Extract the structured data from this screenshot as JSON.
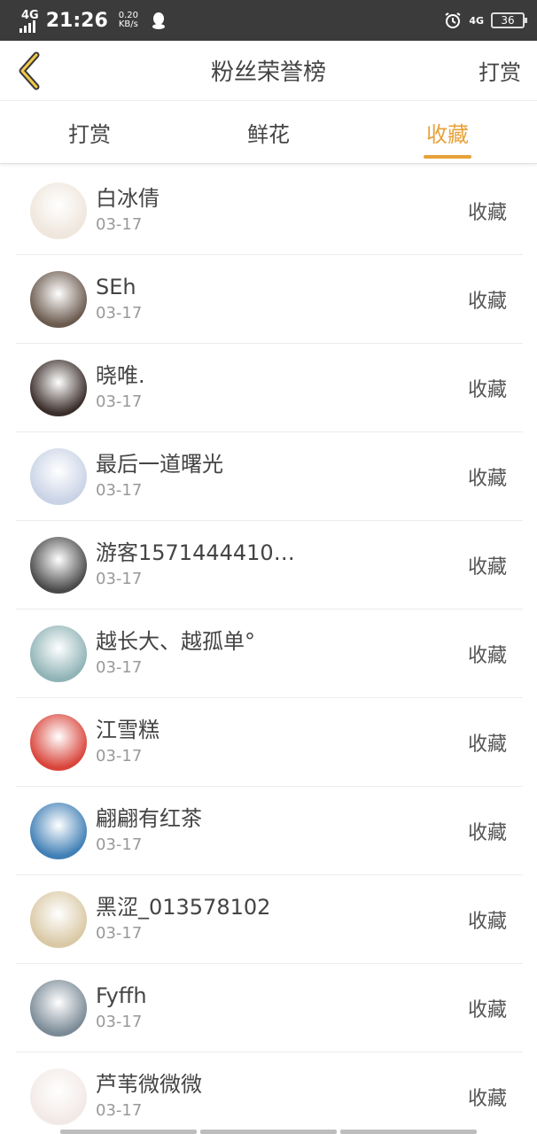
{
  "status_bar": {
    "network_left": "4G",
    "time": "21:26",
    "speed_value": "0.20",
    "speed_unit": "KB/s",
    "network_right": "4G",
    "battery": "36"
  },
  "header": {
    "title": "粉丝荣誉榜",
    "right_action": "打赏"
  },
  "tabs": [
    {
      "label": "打赏",
      "active": false
    },
    {
      "label": "鲜花",
      "active": false
    },
    {
      "label": "收藏",
      "active": true
    }
  ],
  "colors": {
    "accent": "#e8a13a",
    "status_bar": "#3b3b3b"
  },
  "rows": [
    {
      "name": "白冰倩",
      "date": "03-17",
      "action": "收藏",
      "avatar_color": "#efe6dc"
    },
    {
      "name": "SEh",
      "date": "03-17",
      "action": "收藏",
      "avatar_color": "#6b5a4e"
    },
    {
      "name": "晓唯.",
      "date": "03-17",
      "action": "收藏",
      "avatar_color": "#3a2d2a"
    },
    {
      "name": "最后一道曙光",
      "date": "03-17",
      "action": "收藏",
      "avatar_color": "#c9d3e6"
    },
    {
      "name": "游客1571444410…",
      "date": "03-17",
      "action": "收藏",
      "avatar_color": "#4a4a4a"
    },
    {
      "name": "越长大、越孤单°",
      "date": "03-17",
      "action": "收藏",
      "avatar_color": "#8fb3b6"
    },
    {
      "name": "江雪糕",
      "date": "03-17",
      "action": "收藏",
      "avatar_color": "#d9443a"
    },
    {
      "name": "翩翩有红茶",
      "date": "03-17",
      "action": "收藏",
      "avatar_color": "#3f7fb5"
    },
    {
      "name": "黑涩_013578102",
      "date": "03-17",
      "action": "收藏",
      "avatar_color": "#d9c8a4"
    },
    {
      "name": "Fyffh",
      "date": "03-17",
      "action": "收藏",
      "avatar_color": "#7a8a96"
    },
    {
      "name": "芦苇微微微",
      "date": "03-17",
      "action": "收藏",
      "avatar_color": "#f2e9e6"
    }
  ]
}
